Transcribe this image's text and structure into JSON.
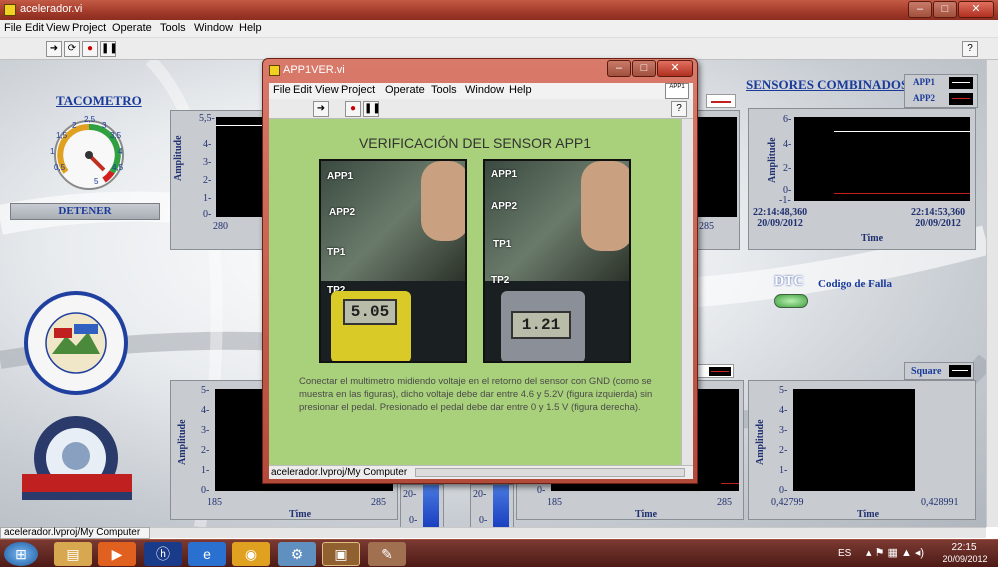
{
  "main": {
    "title": "acelerador.vi",
    "menu": [
      "File",
      "Edit",
      "View",
      "Project",
      "Operate",
      "Tools",
      "Window",
      "Help"
    ],
    "path": "acelerador.lvproj/My Computer",
    "tacometro": {
      "title": "TACOMETRO",
      "dial_labels": [
        "0,5",
        "1",
        "1,5",
        "2",
        "2,5",
        "3",
        "3,5",
        "4",
        "4,5",
        "5"
      ],
      "value": 3.8
    },
    "detener": "DETENER",
    "graph_top_left": {
      "y_ticks": [
        "5,5-",
        "4-",
        "3-",
        "2-",
        "1-",
        "0-"
      ],
      "x_ticks": [
        "280"
      ],
      "y_title": "Amplitude"
    },
    "graph_top_mid": {
      "x_tick": "285"
    },
    "sensores": {
      "title": "SENSORES COMBINADOS",
      "legend": [
        "APP1",
        "APP2"
      ],
      "y_ticks": [
        "6-",
        "4-",
        "2-",
        "0-",
        "-1-"
      ],
      "x_ticks": [
        "22:14:48,360\n20/09/2012",
        "22:14:53,360\n20/09/2012"
      ],
      "x_title": "Time",
      "y_title": "Amplitude"
    },
    "dtc": {
      "label": "DTC",
      "sub": "Codigo de Falla"
    },
    "square_legend": "Square",
    "graph_bl": {
      "y_ticks": [
        "5-",
        "4-",
        "3-",
        "2-",
        "1-",
        "0-"
      ],
      "x_ticks": [
        "185",
        "285"
      ],
      "x_title": "Time",
      "y_title": "Amplitude"
    },
    "graph_bm": {
      "x_ticks": [
        "185",
        "285"
      ],
      "x_title": "Time",
      "y_ticks": [
        "0-"
      ]
    },
    "graph_mini": {
      "ticks1": [
        "20-",
        "0-"
      ],
      "ticks2": [
        "20-",
        "0-"
      ]
    },
    "graph_br": {
      "y_ticks": [
        "5-",
        "4-",
        "3-",
        "2-",
        "1-",
        "0-"
      ],
      "x_ticks": [
        "0,42799",
        "0,428991"
      ],
      "x_title": "Time",
      "y_title": "Amplitude"
    },
    "legend_mid_label": "2"
  },
  "child": {
    "title": "APP1VER.vi",
    "menu": [
      "File",
      "Edit",
      "View",
      "Project",
      "Operate",
      "Tools",
      "Window",
      "Help"
    ],
    "heading": "VERIFICACIÓN DEL SENSOR APP1",
    "photo_labels": [
      "APP1",
      "APP2",
      "TP1",
      "TP2"
    ],
    "readings": [
      "5.05",
      "1.21"
    ],
    "description": "Conectar el multimetro midiendo voltaje en el retorno del sensor con GND (como se muestra en las figuras), dicho voltaje debe dar entre 4.6 y 5.2V (figura izquierda) sin presionar el pedal. Presionado el pedal debe dar entre 0 y 1.5 V (figura derecha).",
    "footer_path": "acelerador.lvproj/My Computer",
    "app_badge": "APP1"
  },
  "taskbar": {
    "lang": "ES",
    "time": "22:15",
    "date": "20/09/2012"
  },
  "colors": {
    "accent": "#1a3a9a",
    "panel_green": "#a9d07a",
    "title_red": "#a23a2a"
  }
}
